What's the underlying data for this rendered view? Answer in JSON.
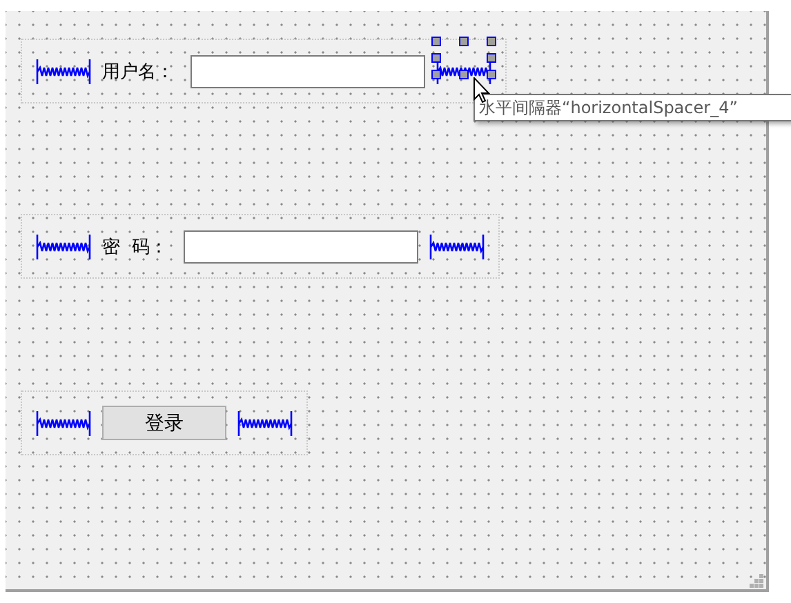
{
  "layouts": [
    {
      "items": [
        {
          "kind": "spacer",
          "selected": false
        },
        {
          "kind": "label",
          "text": "用户名："
        },
        {
          "kind": "input"
        },
        {
          "kind": "spacer",
          "selected": true
        }
      ]
    },
    {
      "items": [
        {
          "kind": "spacer",
          "selected": false
        },
        {
          "kind": "label",
          "text": "密  码："
        },
        {
          "kind": "input"
        },
        {
          "kind": "spacer",
          "selected": false
        }
      ]
    },
    {
      "items": [
        {
          "kind": "spacer",
          "selected": false
        },
        {
          "kind": "button",
          "text": "登录"
        },
        {
          "kind": "spacer",
          "selected": false
        }
      ]
    }
  ],
  "tooltip": {
    "text": "水平间隔器“horizontalSpacer_4”"
  }
}
